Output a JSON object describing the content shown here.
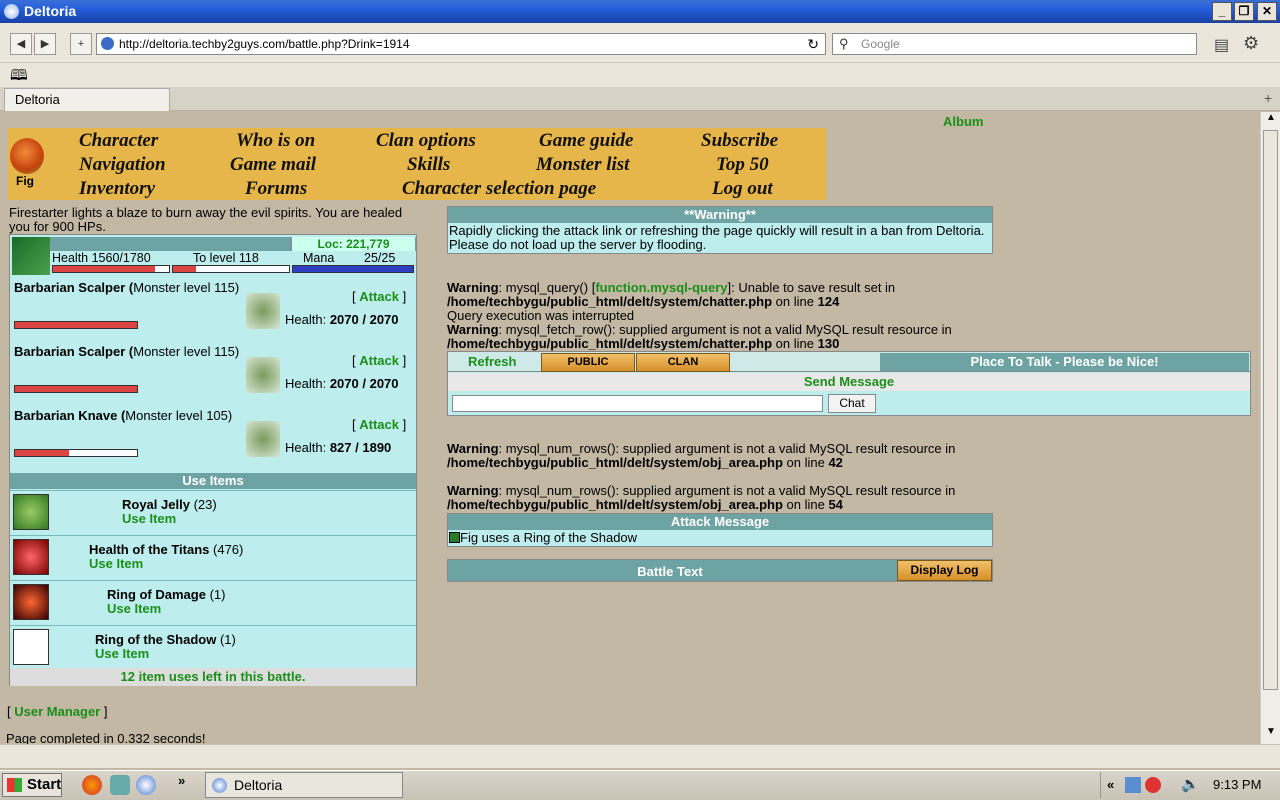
{
  "window": {
    "title": "Deltoria"
  },
  "browser": {
    "url": "http://deltoria.techby2guys.com/battle.php?Drink=1914",
    "search_placeholder": "Google",
    "tab_title": "Deltoria"
  },
  "page": {
    "album": "Album",
    "char_name": "Fig",
    "menu": [
      [
        "Character",
        "Who is on",
        "Clan options",
        "Game guide",
        "Subscribe"
      ],
      [
        "Navigation",
        "Game mail",
        "Skills",
        "Monster list",
        "Top 50"
      ],
      [
        "Inventory",
        "Forums",
        "Character selection page",
        "Log out"
      ]
    ],
    "heal_msg": "Firestarter lights a blaze to burn away the evil spirits. You are healed you for 900 HPs.",
    "loc": "Loc: 221,779",
    "health": "Health 1560/1780",
    "tolevel": "To level 118",
    "mana": "Mana",
    "mana_val": "25/25",
    "health_frac": 0.876,
    "monsters": [
      {
        "name": "Barbarian Scalper",
        "open": " (",
        "level": "Monster level 115)",
        "attack": "Attack",
        "hp_label": "Health:",
        "hp": "2070 / 2070",
        "frac": 1.0
      },
      {
        "name": "Barbarian Scalper",
        "open": " (",
        "level": "Monster level 115)",
        "attack": "Attack",
        "hp_label": "Health:",
        "hp": "2070 / 2070",
        "frac": 1.0
      },
      {
        "name": "Barbarian Knave",
        "open": " (",
        "level": "Monster level 105)",
        "attack": "Attack",
        "hp_label": "Health:",
        "hp": "827 / 1890",
        "frac": 0.44
      }
    ],
    "bracket_l": "[",
    "bracket_r": "]",
    "use_items_hdr": "Use Items",
    "items": [
      {
        "name": "Royal Jelly",
        "qty": "(23)",
        "use": "Use Item"
      },
      {
        "name": "Health of the Titans",
        "qty": "(476)",
        "use": "Use Item"
      },
      {
        "name": "Ring of Damage",
        "qty": "(1)",
        "use": "Use Item"
      },
      {
        "name": "Ring of the Shadow",
        "qty": "(1)",
        "use": "Use Item"
      }
    ],
    "uses_left": "12 item uses left in this battle.",
    "user_manager": "User Manager",
    "page_completed": "Page completed in 0.332 seconds!",
    "warning_hdr": "**Warning**",
    "warning_text": "Rapidly clicking the attack link or refreshing the page quickly will result in a ban from Deltoria. Please do not load up the server by flooding.",
    "php1_a": "Warning",
    "php1_b": ": mysql_query() [",
    "php1_link": "function.mysql-query",
    "php1_c": "]: Unable to save result set in",
    "php1_path": "/home/techbygu/public_html/delt/system/chatter.php",
    "php1_on": " on line ",
    "php1_line": "124",
    "php_interrupted": "Query execution was interrupted",
    "php2_a": "Warning",
    "php2_b": ": mysql_fetch_row(): supplied argument is not a valid MySQL result resource in",
    "php2_path": "/home/techbygu/public_html/delt/system/chatter.php",
    "php2_line": "130",
    "chat": {
      "refresh": "Refresh",
      "public": "PUBLIC",
      "clan": "CLAN",
      "title": "Place To Talk - Please be Nice!",
      "send": "Send Message",
      "chat_btn": "Chat"
    },
    "php3_a": "Warning",
    "php3_b": ": mysql_num_rows(): supplied argument is not a valid MySQL result resource in",
    "php3_path": "/home/techbygu/public_html/delt/system/obj_area.php",
    "php3_line": "42",
    "php4_path": "/home/techbygu/public_html/delt/system/obj_area.php",
    "php4_line": "54",
    "attack_hdr": "Attack Message",
    "attack_msg": "Fig uses a Ring of the Shadow",
    "battle_text": "Battle Text",
    "display_log": "Display Log"
  },
  "taskbar": {
    "start": "Start",
    "item": "Deltoria",
    "time": "9:13 PM",
    "chev": "»",
    "chev2": "«"
  }
}
